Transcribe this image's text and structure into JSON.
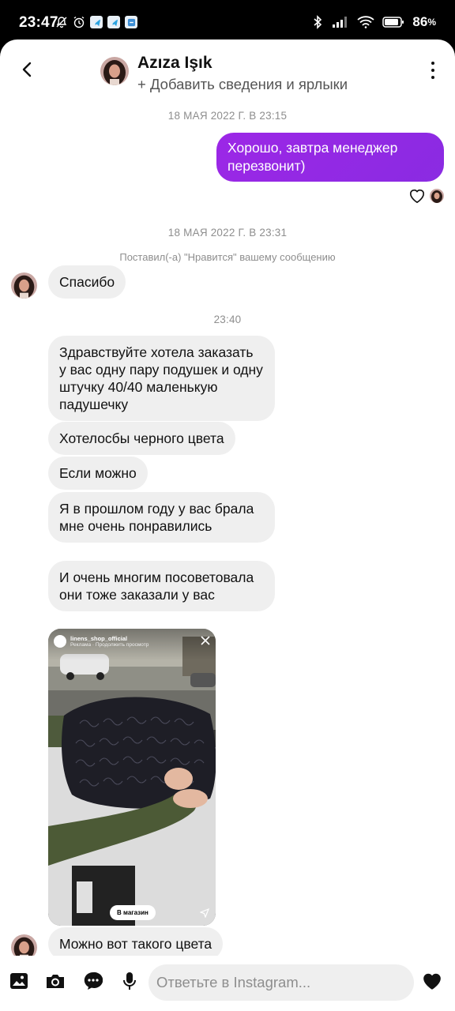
{
  "status_bar": {
    "time": "23:47",
    "battery": "86"
  },
  "header": {
    "name": "Azıza Işık",
    "subtitle": "+ Добавить сведения и ярлыки"
  },
  "messages": {
    "ts1": "18 МАЯ 2022 Г. В 23:15",
    "out1": "Хорошо, завтра менеджер перезвонит)",
    "ts2": "18 МАЯ 2022 Г. В 23:31",
    "system_like": "Поставил(-а) \"Нравится\" вашему сообщению",
    "in1": "Спасибо",
    "ts3": "23:40",
    "in2": "Здравствуйте хотела заказать у вас одну пару подушек и одну штучку 40/40 маленькую падушечку",
    "in3": "Хотелосбы черного цвета",
    "in4": "Если можно",
    "in5": "Я в прошлом году у вас брала мне очень понравились",
    "in6": "И очень многим посоветовала они тоже заказали у вас",
    "in7": "Можно вот такого цвета"
  },
  "shared_post": {
    "account": "linens_shop_official",
    "ad_line": "Реклама · Продолжить просмотр",
    "cta": "В магазин"
  },
  "composer": {
    "placeholder": "Ответьте в Instagram..."
  },
  "colors": {
    "outgoing_bubble": "#9b2ae6",
    "incoming_bubble": "#efefef",
    "timestamp": "#8e8e8e"
  },
  "icons": [
    "back-arrow-icon",
    "more-vertical-icon",
    "heart-outline-icon",
    "gallery-icon",
    "camera-icon",
    "sticker-icon",
    "microphone-icon",
    "heart-filled-icon"
  ]
}
